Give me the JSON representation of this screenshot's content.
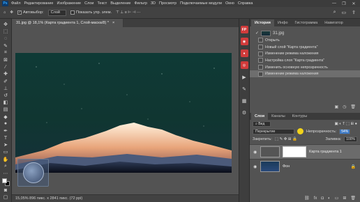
{
  "menubar": {
    "logo": "Ps",
    "items": [
      "Файл",
      "Редактирование",
      "Изображение",
      "Слои",
      "Текст",
      "Выделение",
      "Фильтр",
      "3D",
      "Просмотр",
      "Подключаемые модули",
      "Окно",
      "Справка"
    ],
    "window_controls": [
      "—",
      "❐",
      "✕"
    ]
  },
  "optionsbar": {
    "move_icon": "move-icon",
    "autoselect_label": "Автовыбор:",
    "autoselect_value": "Слой",
    "transform_label": "Показать упр. элем."
  },
  "document": {
    "tab_title": "31.jpg @ 18,1% (Карта градиента 1, Слой-маска/8) *",
    "close": "×"
  },
  "status": {
    "text": "15,05%  896 пикс. x 2841 пикс. (72 ppi)"
  },
  "iconcol": {
    "badges": [
      "FP",
      "",
      "",
      ""
    ]
  },
  "history_panel": {
    "tabs": [
      "История",
      "Инфо",
      "Гистограмма",
      "Навигатор"
    ],
    "snapshot": "31.jpg",
    "items": [
      "Открыть",
      "Новый слой \"Карта градиента\"",
      "Изменение режима наложения",
      "Настройка слоя \"Карта градиента\"",
      "Изменить основную непрозрачность",
      "Изменение режима наложения"
    ],
    "selected_index": 5
  },
  "layers_panel": {
    "tabs": [
      "Слои",
      "Каналы",
      "Контуры"
    ],
    "filter_label": "Вид",
    "blend_mode": "Перекрытие",
    "opacity_label": "Непрозрачность:",
    "opacity_value": "54%",
    "lock_label": "Закрепить:",
    "fill_label": "Заливка:",
    "fill_value": "100%",
    "layers": [
      {
        "name": "Карта градиента 1",
        "selected": true
      },
      {
        "name": "Фон",
        "selected": false
      }
    ]
  }
}
